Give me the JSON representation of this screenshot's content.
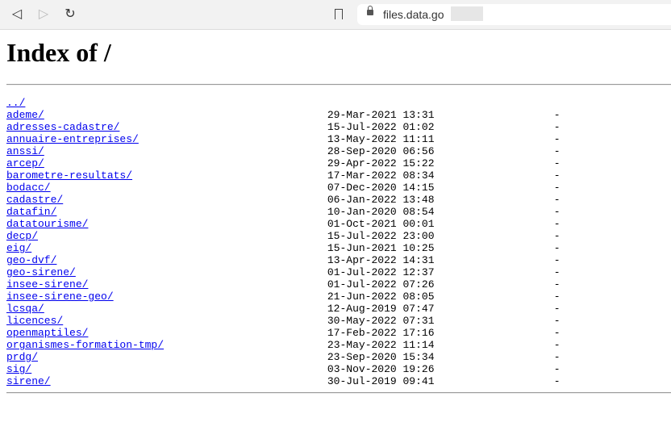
{
  "browser": {
    "url": "files.data.go",
    "icons": [
      "back-icon",
      "forward-icon",
      "reload-icon",
      "bookmark-icon",
      "lock-icon"
    ]
  },
  "page": {
    "title": "Index of /"
  },
  "parent": {
    "name": "../"
  },
  "entries": [
    {
      "name": "ademe/",
      "date": "29-Mar-2021 13:31",
      "size": "-"
    },
    {
      "name": "adresses-cadastre/",
      "date": "15-Jul-2022 01:02",
      "size": "-"
    },
    {
      "name": "annuaire-entreprises/",
      "date": "13-May-2022 11:11",
      "size": "-"
    },
    {
      "name": "anssi/",
      "date": "28-Sep-2020 06:56",
      "size": "-"
    },
    {
      "name": "arcep/",
      "date": "29-Apr-2022 15:22",
      "size": "-"
    },
    {
      "name": "barometre-resultats/",
      "date": "17-Mar-2022 08:34",
      "size": "-"
    },
    {
      "name": "bodacc/",
      "date": "07-Dec-2020 14:15",
      "size": "-"
    },
    {
      "name": "cadastre/",
      "date": "06-Jan-2022 13:48",
      "size": "-"
    },
    {
      "name": "datafin/",
      "date": "10-Jan-2020 08:54",
      "size": "-"
    },
    {
      "name": "datatourisme/",
      "date": "01-Oct-2021 00:01",
      "size": "-"
    },
    {
      "name": "decp/",
      "date": "15-Jul-2022 23:00",
      "size": "-"
    },
    {
      "name": "eig/",
      "date": "15-Jun-2021 10:25",
      "size": "-"
    },
    {
      "name": "geo-dvf/",
      "date": "13-Apr-2022 14:31",
      "size": "-"
    },
    {
      "name": "geo-sirene/",
      "date": "01-Jul-2022 12:37",
      "size": "-"
    },
    {
      "name": "insee-sirene/",
      "date": "01-Jul-2022 07:26",
      "size": "-"
    },
    {
      "name": "insee-sirene-geo/",
      "date": "21-Jun-2022 08:05",
      "size": "-"
    },
    {
      "name": "lcsqa/",
      "date": "12-Aug-2019 07:47",
      "size": "-"
    },
    {
      "name": "licences/",
      "date": "30-May-2022 07:31",
      "size": "-"
    },
    {
      "name": "openmaptiles/",
      "date": "17-Feb-2022 17:16",
      "size": "-"
    },
    {
      "name": "organismes-formation-tmp/",
      "date": "23-May-2022 11:14",
      "size": "-"
    },
    {
      "name": "prdg/",
      "date": "23-Sep-2020 15:34",
      "size": "-"
    },
    {
      "name": "sig/",
      "date": "03-Nov-2020 19:26",
      "size": "-"
    },
    {
      "name": "sirene/",
      "date": "30-Jul-2019 09:41",
      "size": "-"
    }
  ]
}
